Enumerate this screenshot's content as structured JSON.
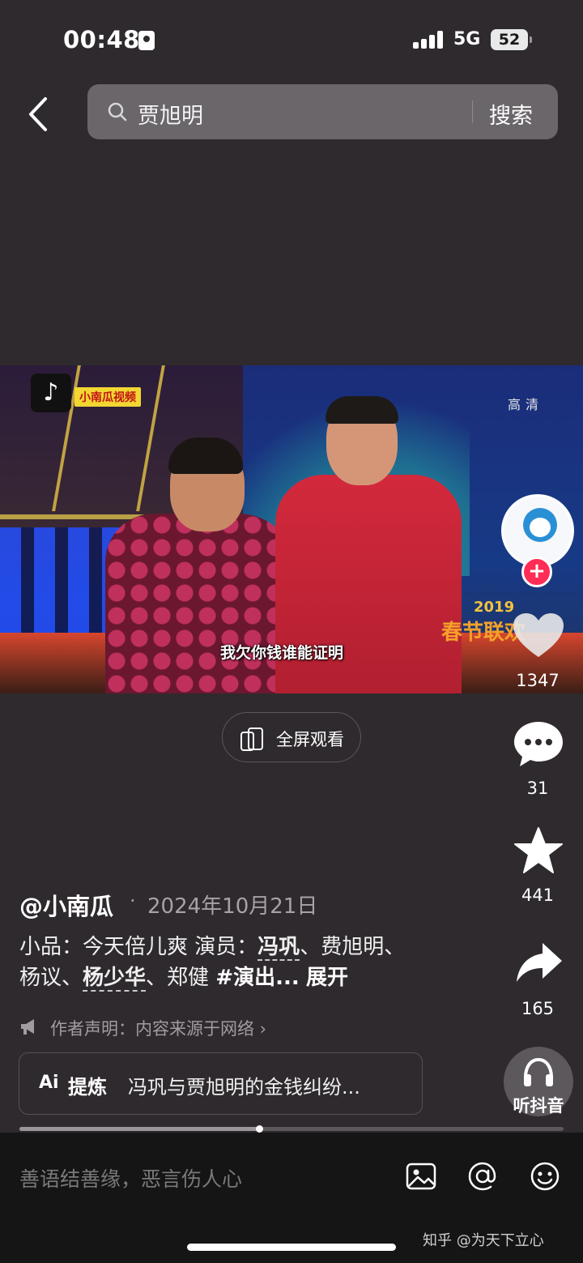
{
  "status_bar": {
    "time": "00:48",
    "network": "5G",
    "battery": "52"
  },
  "search": {
    "value": "贾旭明",
    "button": "搜索"
  },
  "video": {
    "logo": "♪",
    "source_tag": "小南瓜视频",
    "quality": "高清",
    "subtitle": "我欠你钱谁能证明",
    "gala_year": "2019",
    "gala_title": "春节联欢"
  },
  "rail": {
    "likes": "1347",
    "comments": "31",
    "favorites": "441",
    "shares": "165",
    "follow": "+"
  },
  "fullscreen_label": "全屏观看",
  "post": {
    "author": "@小南瓜",
    "separator": "·",
    "date": "2024年10月21日",
    "desc_prefix": "小品：今天倍儿爽 演员：",
    "actor1": "冯巩",
    "desc_mid": "、费旭明、杨议、",
    "actor2": "杨少华",
    "desc_suffix": "、郑健 ",
    "hashtag": "#演出...",
    "expand": "展开",
    "declaration": "作者声明：内容来源于网络 ›"
  },
  "summary": {
    "icon": "Ai",
    "label": "提炼",
    "text": "冯巩与贾旭明的金钱纠纷..."
  },
  "listen_label": "听抖音",
  "progress": {
    "value": 0.44
  },
  "comment": {
    "placeholder": "善语结善缘，恶言伤人心"
  },
  "watermark": "知乎 @为天下立心",
  "colors": {
    "follow": "#ff2c55",
    "tag_bg": "#f2d632",
    "tag_text": "#c21414"
  }
}
